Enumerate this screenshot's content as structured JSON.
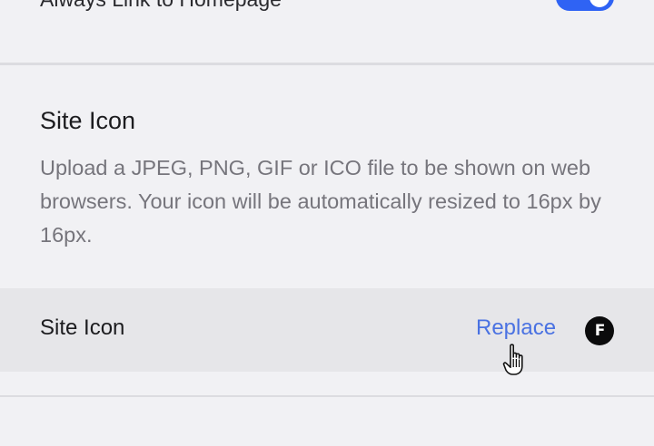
{
  "top_setting": {
    "label": "Always Link to Homepage",
    "toggle_on": true,
    "toggle_color": "#2f63f4"
  },
  "site_icon_section": {
    "title": "Site Icon",
    "description": "Upload a JPEG, PNG, GIF or ICO file to be shown on web browsers. Your icon will be automatically resized to 16px by 16px.",
    "row_label": "Site Icon",
    "replace_label": "Replace",
    "favicon_letter": "F",
    "link_color": "#4a72e2"
  },
  "cursor": {
    "type": "hand-pointer-icon"
  }
}
